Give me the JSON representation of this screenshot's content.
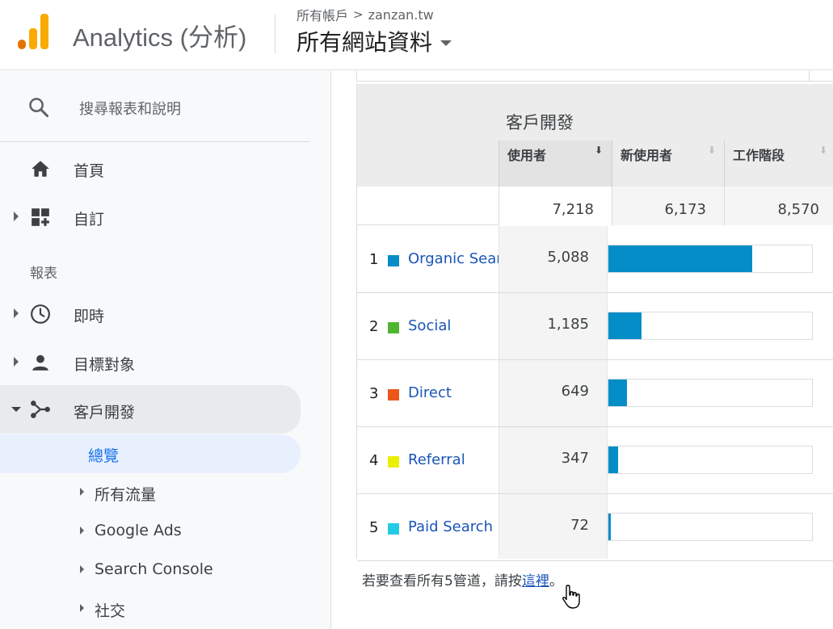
{
  "header": {
    "brand": "Analytics (分析)",
    "breadcrumb": {
      "account": "所有帳戶",
      "separator": ">",
      "site": "zanzan.tw"
    },
    "property": "所有網站資料"
  },
  "sidebar": {
    "search_placeholder": "搜尋報表和說明",
    "items": [
      {
        "label": "首頁",
        "icon": "home-icon"
      },
      {
        "label": "自訂",
        "icon": "dashboard-add-icon"
      }
    ],
    "section_label": "報表",
    "report_items": [
      {
        "label": "即時",
        "icon": "clock-icon"
      },
      {
        "label": "目標對象",
        "icon": "person-icon"
      },
      {
        "label": "客戶開發",
        "icon": "acquisition-icon"
      }
    ],
    "sub_items": [
      {
        "label": "總覽",
        "selected": true
      },
      {
        "label": "所有流量"
      },
      {
        "label": "Google Ads"
      },
      {
        "label": "Search Console"
      },
      {
        "label": "社交"
      }
    ]
  },
  "table": {
    "group_title": "客戶開發",
    "columns": [
      {
        "name": "使用者",
        "sorted": true
      },
      {
        "name": "新使用者",
        "sorted": false
      },
      {
        "name": "工作階段",
        "sorted": false
      }
    ],
    "totals": {
      "users": "7,218",
      "new_users": "6,173",
      "sessions": "8,570"
    },
    "rows": [
      {
        "rank": "1",
        "channel": "Organic Search",
        "users": "5,088",
        "users_num": 5088,
        "color": "#058dc7"
      },
      {
        "rank": "2",
        "channel": "Social",
        "users": "1,185",
        "users_num": 1185,
        "color": "#50b432"
      },
      {
        "rank": "3",
        "channel": "Direct",
        "users": "649",
        "users_num": 649,
        "color": "#ed561b"
      },
      {
        "rank": "4",
        "channel": "Referral",
        "users": "347",
        "users_num": 347,
        "color": "#edef00"
      },
      {
        "rank": "5",
        "channel": "Paid Search",
        "users": "72",
        "users_num": 72,
        "color": "#24cbe5"
      }
    ],
    "bar_max": 7218
  },
  "footnote": {
    "prefix": "若要查看所有5管道，請按",
    "link": "這裡",
    "suffix": "。"
  }
}
